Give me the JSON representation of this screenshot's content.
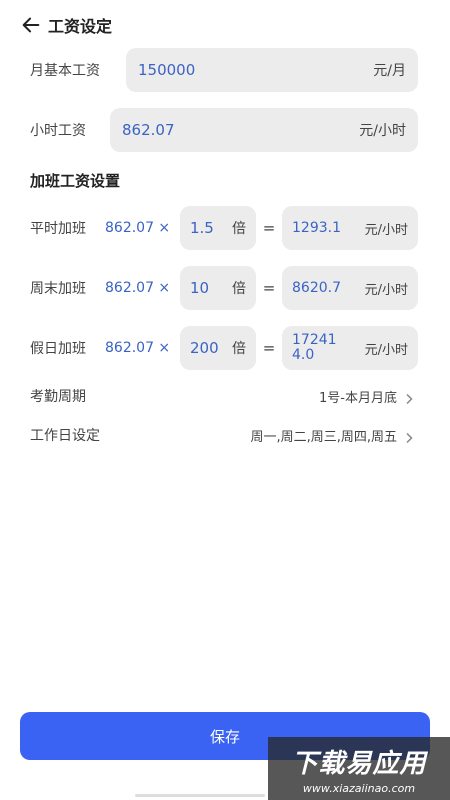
{
  "header": {
    "back_icon": "arrow-left-icon",
    "title": "工资设定"
  },
  "base": {
    "monthly_label": "月基本工资",
    "monthly_value": "150000",
    "monthly_unit": "元/月",
    "hourly_label": "小时工资",
    "hourly_value": "862.07",
    "hourly_unit": "元/小时"
  },
  "overtime": {
    "title": "加班工资设置",
    "rows": [
      {
        "label": "平时加班",
        "rate": "862.07 ×",
        "multiplier": "1.5",
        "mult_unit": "倍",
        "eq": "=",
        "result": "1293.1",
        "result_unit": "元/小时"
      },
      {
        "label": "周末加班",
        "rate": "862.07 ×",
        "multiplier": "10",
        "mult_unit": "倍",
        "eq": "=",
        "result": "8620.7",
        "result_unit": "元/小时"
      },
      {
        "label": "假日加班",
        "rate": "862.07 ×",
        "multiplier": "200",
        "mult_unit": "倍",
        "eq": "=",
        "result": "172414.0",
        "result_unit": "元/小时"
      }
    ]
  },
  "settings": {
    "attendance_label": "考勤周期",
    "attendance_value": "1号-本月月底",
    "workday_label": "工作日设定",
    "workday_value": "周一,周二,周三,周四,周五",
    "chevron_icon": "chevron-right-icon"
  },
  "actions": {
    "save_label": "保存"
  },
  "watermark": {
    "main": "下载易应用",
    "url": "www.xiazaiinao.com"
  },
  "colors": {
    "accent": "#3a63f4",
    "value_blue": "#3b63c4",
    "field_bg": "#ececec"
  }
}
